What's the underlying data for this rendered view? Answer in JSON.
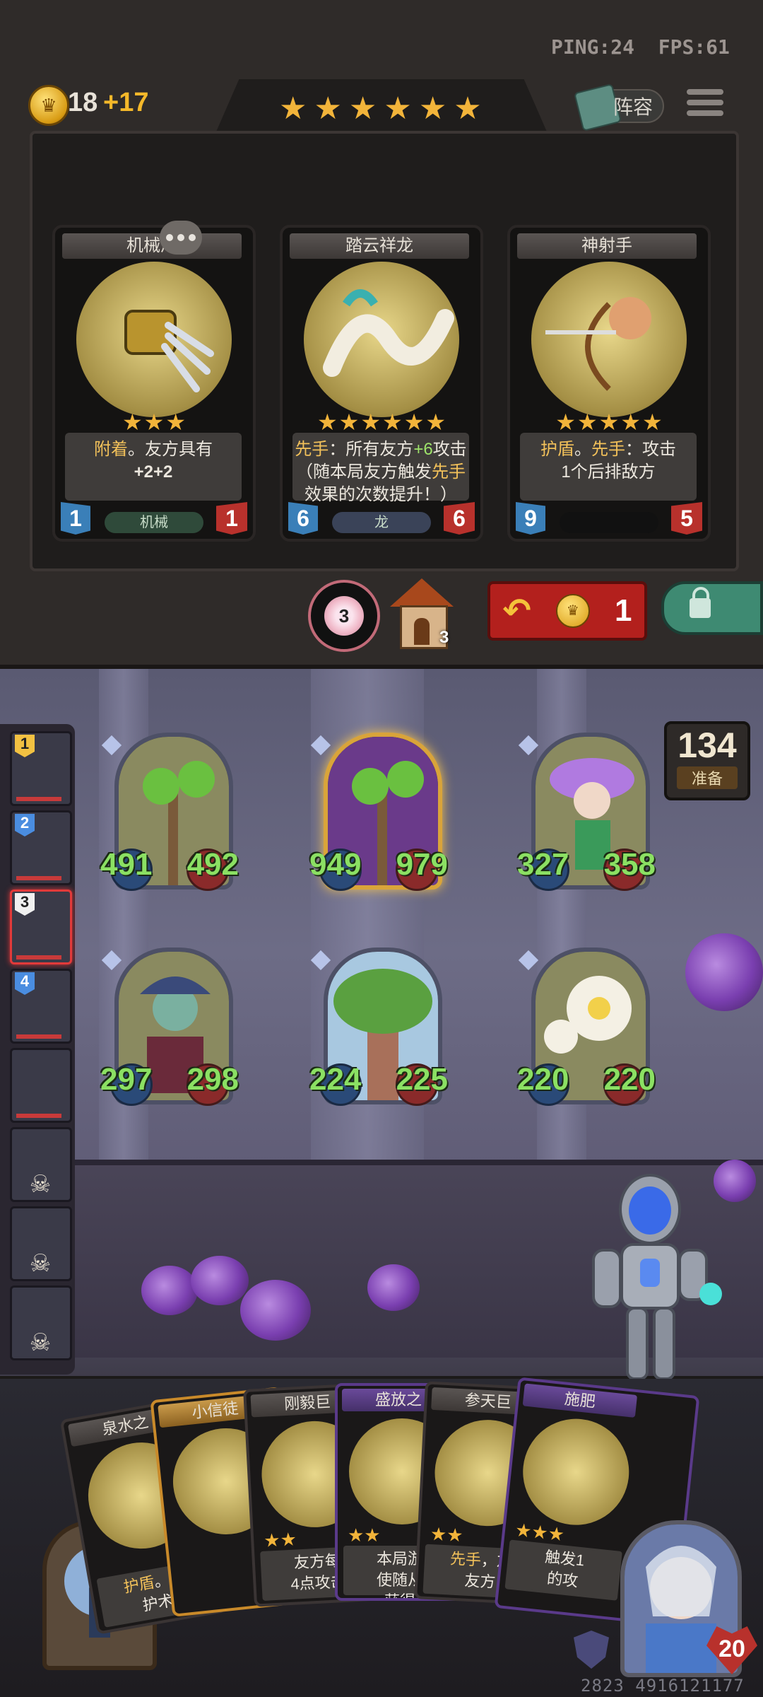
{
  "status": {
    "ping": "PING:24",
    "fps": "FPS:61"
  },
  "gold": {
    "amount": "18",
    "income": "+17",
    "coin_glyph": "♛"
  },
  "tier_stars": [
    "★",
    "★",
    "★",
    "★",
    "★",
    "★"
  ],
  "lineup_button": "阵容",
  "shop_cards": [
    {
      "name": "机械爪",
      "name_visible": "机械爪",
      "stars": [
        "★",
        "★",
        "★"
      ],
      "desc_html": "<span class='hl'>附着</span>。友方具有<br><b>+2+2</b>",
      "attack": "1",
      "health": "1",
      "tribe": "机械"
    },
    {
      "name": "踏云祥龙",
      "stars": [
        "★",
        "★",
        "★",
        "★",
        "★",
        "★"
      ],
      "desc_html": "<span class='hl'>先手</span>：所有友方<span class='gr'>+6</span>攻击<br>（随本局友方触发<span class='hl'>先手</span><br>效果的次数提升！）",
      "attack": "6",
      "health": "6",
      "tribe": "龙"
    },
    {
      "name": "神射手",
      "stars": [
        "★",
        "★",
        "★",
        "★",
        "★"
      ],
      "desc_html": "<span class='hl'>护盾</span>。<span class='hl'>先手</span>：攻击<br>1个后排敌方",
      "attack": "9",
      "health": "5",
      "tribe": ""
    }
  ],
  "pity_counter": "3",
  "house_count": "3",
  "refresh": {
    "cost": "1",
    "arrow_glyph": "↶",
    "coin_glyph": "♛"
  },
  "timer": {
    "value": "134",
    "label": "准备"
  },
  "roster": [
    {
      "num": "1",
      "style": "gold",
      "active": false,
      "dead": false
    },
    {
      "num": "2",
      "style": "blue",
      "active": false,
      "dead": false
    },
    {
      "num": "3",
      "style": "wht",
      "active": true,
      "dead": false
    },
    {
      "num": "4",
      "style": "blue",
      "active": false,
      "dead": false
    },
    {
      "num": "",
      "style": "",
      "active": false,
      "dead": false
    },
    {
      "num": "",
      "style": "",
      "active": false,
      "dead": true
    },
    {
      "num": "",
      "style": "",
      "active": false,
      "dead": true
    },
    {
      "num": "",
      "style": "",
      "active": false,
      "dead": true
    }
  ],
  "board": [
    {
      "attack": "491",
      "health": "492",
      "art": "tree-small",
      "golden": false
    },
    {
      "attack": "949",
      "health": "979",
      "art": "tree-small",
      "golden": true
    },
    {
      "attack": "327",
      "health": "358",
      "art": "fairy",
      "golden": false
    },
    {
      "attack": "297",
      "health": "298",
      "art": "elf",
      "golden": false
    },
    {
      "attack": "224",
      "health": "225",
      "art": "baobab",
      "golden": false
    },
    {
      "attack": "220",
      "health": "220",
      "art": "flower",
      "golden": false
    }
  ],
  "hand": [
    {
      "name": "泉水之",
      "stars": "",
      "desc_html": "<span class='hl'>护盾</span>。扔<br>护术",
      "style": ""
    },
    {
      "name": "小信徒",
      "stars": "",
      "desc_html": "",
      "style": "gold"
    },
    {
      "name": "刚毅巨",
      "stars": "★★",
      "desc_html": "友方每<br>4点攻击",
      "style": ""
    },
    {
      "name": "盛放之",
      "stars": "★★",
      "desc_html": "本局游<br>使随从<br>获得",
      "style": "purple"
    },
    {
      "name": "参天巨",
      "stars": "★★",
      "desc_html": "<span class='hl'>先手</span>，友<br>友方",
      "style": ""
    },
    {
      "name": "施肥",
      "stars": "★★★",
      "desc_html": "触发1<br>的攻",
      "style": "purple"
    }
  ],
  "hero": {
    "health": "20"
  },
  "game_id": "2823 4916121177"
}
